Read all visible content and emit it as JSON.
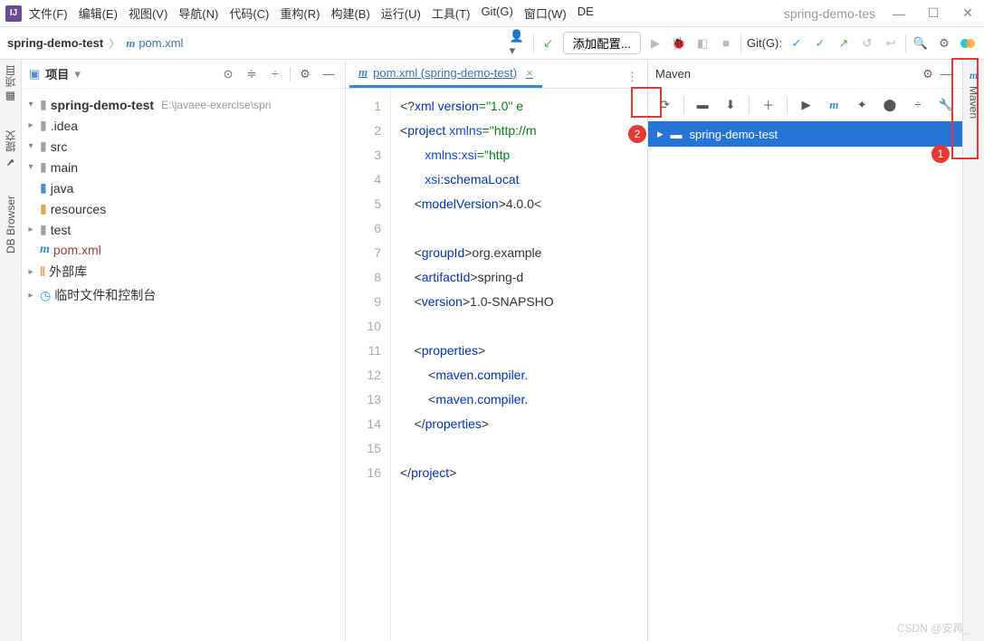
{
  "titlebar": {
    "app_name": "spring-demo-tes",
    "menus": [
      "文件(F)",
      "编辑(E)",
      "视图(V)",
      "导航(N)",
      "代码(C)",
      "重构(R)",
      "构建(B)",
      "运行(U)",
      "工具(T)",
      "Git(G)",
      "窗口(W)",
      "DE"
    ]
  },
  "breadcrumb": {
    "project": "spring-demo-test",
    "file": "pom.xml"
  },
  "runconfig": {
    "label": "添加配置..."
  },
  "git_label": "Git(G):",
  "project_panel": {
    "title": "项目",
    "root": {
      "name": "spring-demo-test",
      "path": "E:\\javaee-exercise\\spri"
    },
    "idea": ".idea",
    "src": "src",
    "main": "main",
    "java": "java",
    "resources": "resources",
    "test": "test",
    "pom": "pom.xml",
    "external": "外部库",
    "scratch": "临时文件和控制台"
  },
  "leftstrip": {
    "project": "项目",
    "commit": "提交",
    "db": "DB Browser"
  },
  "rightstrip": {
    "maven": "Maven"
  },
  "editor": {
    "tab": "pom.xml (spring-demo-test)",
    "gutter": [
      "1",
      "2",
      "3",
      "4",
      "5",
      "6",
      "7",
      "8",
      "9",
      "10",
      "11",
      "12",
      "13",
      "14",
      "15",
      "16"
    ],
    "lines": {
      "l1a": "<?",
      "l1b": "xml version",
      "l1c": "=\"1.0\" e",
      "l2a": "<",
      "l2b": "project ",
      "l2c": "xmlns",
      "l2d": "=\"http://m",
      "l3a": "xmlns:xsi",
      "l3b": "=\"http",
      "l4a": "xsi",
      "l4b": ":schemaLocat",
      "l5a": "<",
      "l5b": "modelVersion",
      "l5c": ">4.0.0<",
      "l7a": "<",
      "l7b": "groupId",
      "l7c": ">org.example",
      "l8a": "<",
      "l8b": "artifactId",
      "l8c": ">spring-d",
      "l9a": "<",
      "l9b": "version",
      "l9c": ">1.0-SNAPSHO",
      "l11a": "<",
      "l11b": "properties",
      "l11c": ">",
      "l12a": "<",
      "l12b": "maven.compiler.",
      "l13a": "<",
      "l13b": "maven.compiler.",
      "l14a": "</",
      "l14b": "properties",
      "l14c": ">",
      "l16a": "</",
      "l16b": "project",
      "l16c": ">"
    }
  },
  "maven": {
    "title": "Maven",
    "project": "spring-demo-test"
  },
  "callouts": {
    "c1": "1",
    "c2": "2"
  },
  "watermark": "CSDN @安苒_"
}
